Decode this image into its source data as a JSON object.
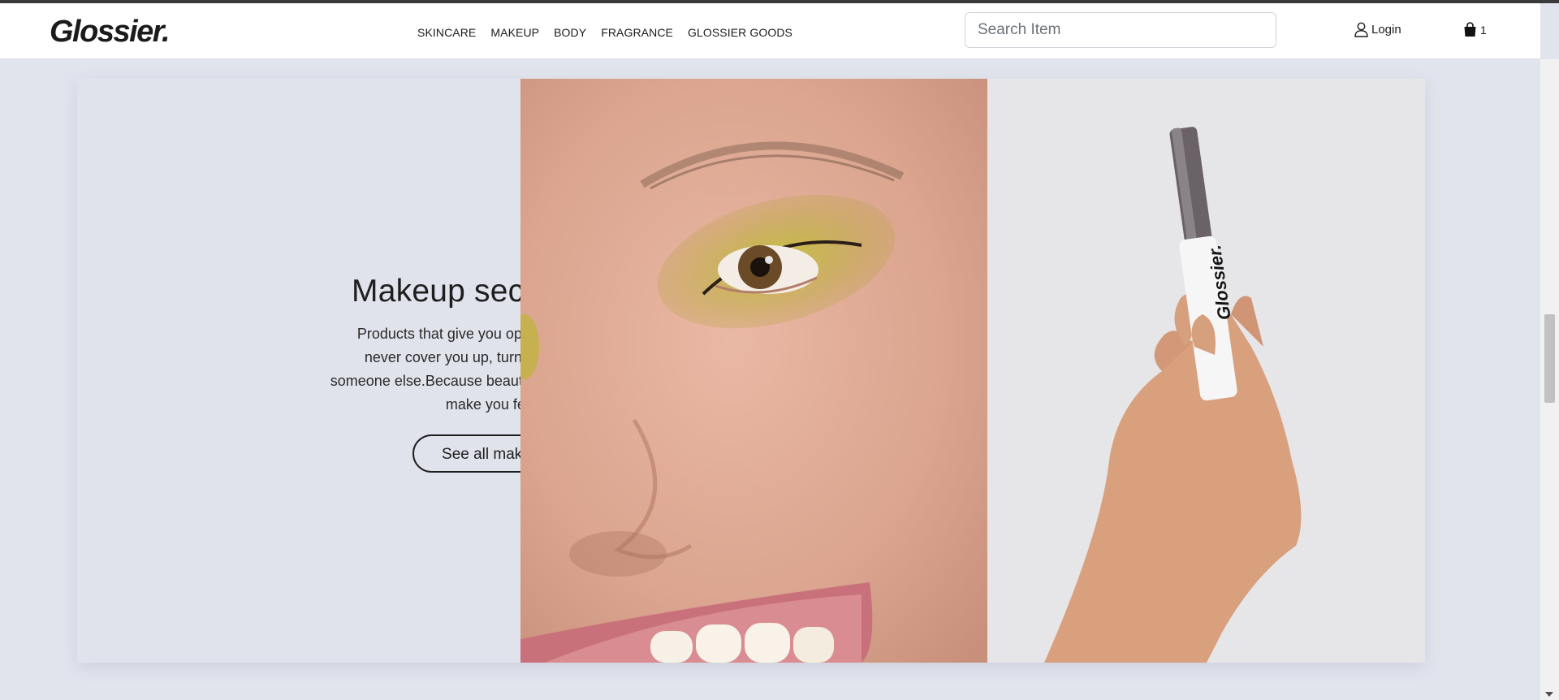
{
  "brand": {
    "logo_text": "Glossier."
  },
  "nav": {
    "items": [
      "SKINCARE",
      "MAKEUP",
      "BODY",
      "FRAGRANCE",
      "GLOSSIER GOODS"
    ]
  },
  "search": {
    "placeholder": "Search Item",
    "value": ""
  },
  "account": {
    "login_label": "Login",
    "icon": "user-icon"
  },
  "cart": {
    "count": "1",
    "icon": "shopping-bag-icon"
  },
  "hero": {
    "title": "Makeup second",
    "description": "Products that give you options but never cover you up, turn you into someone else.Because beauty should make you feel good.",
    "cta_label": "See all makeup",
    "product_text": "Glossier."
  },
  "colors": {
    "background": "#e1e4ed",
    "header": "#ffffff",
    "eyeshadow": "#b6a23a",
    "text": "#1e1e1e"
  }
}
